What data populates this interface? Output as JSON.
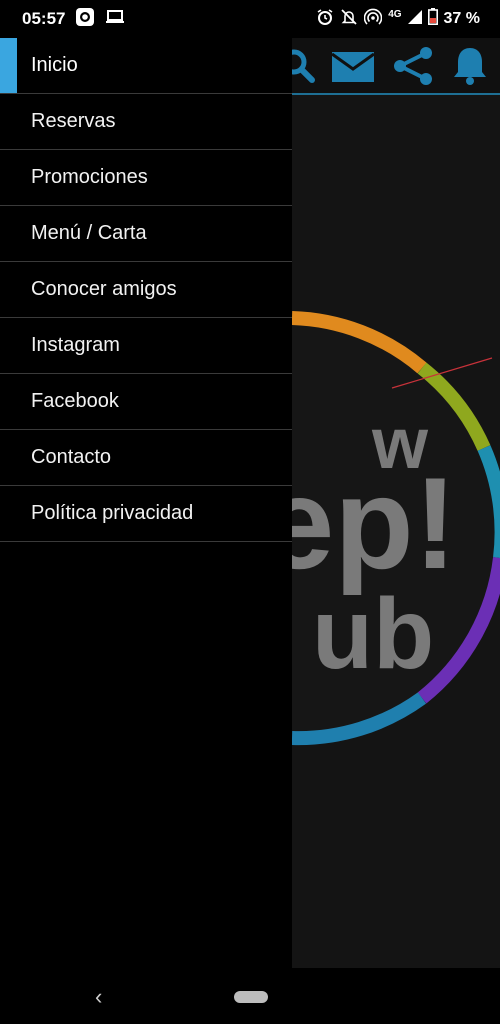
{
  "status": {
    "time": "05:57",
    "network": "4G",
    "battery": "37 %"
  },
  "drawer": {
    "items": [
      {
        "label": "Inicio",
        "active": true
      },
      {
        "label": "Reservas",
        "active": false
      },
      {
        "label": "Promociones",
        "active": false
      },
      {
        "label": "Menú / Carta",
        "active": false
      },
      {
        "label": "Conocer amigos",
        "active": false
      },
      {
        "label": "Instagram",
        "active": false
      },
      {
        "label": "Facebook",
        "active": false
      },
      {
        "label": "Contacto",
        "active": false
      },
      {
        "label": "Política privacidad",
        "active": false
      }
    ]
  },
  "background_app": {
    "logo_text": {
      "line1": "w",
      "line2": "ep!",
      "line3": "ub"
    },
    "toolbar_icons": [
      "search-icon",
      "mail-icon",
      "share-icon",
      "bell-icon"
    ]
  },
  "colors": {
    "accent": "#3aa6e0",
    "toolbar_icon": "#1e7fb0",
    "divider": "#3a3a3a"
  }
}
